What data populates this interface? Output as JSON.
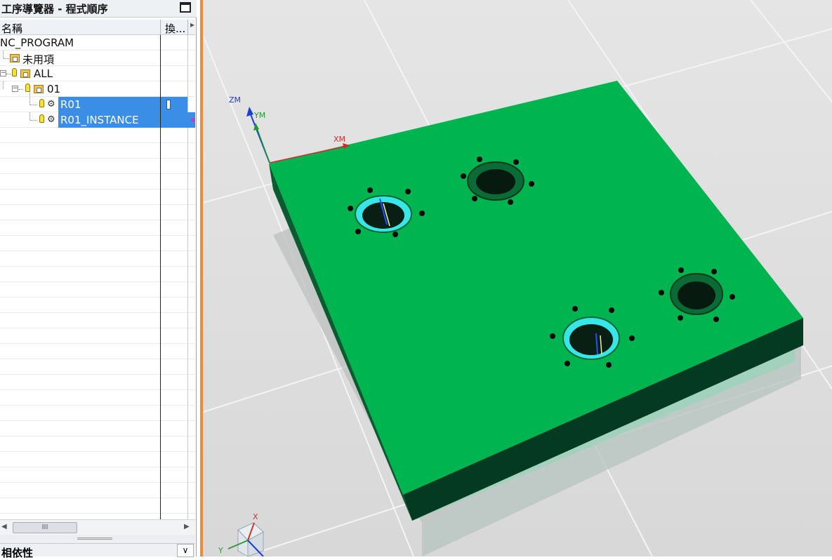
{
  "navigator": {
    "title": "工序導覽器 - 程式順序",
    "columns": {
      "name": "名稱",
      "change": "換..."
    },
    "tree": {
      "root": "NC_PROGRAM",
      "unused": "未用項",
      "all": "ALL",
      "group": "01",
      "ops": [
        "R01",
        "R01_INSTANCE"
      ]
    },
    "scrollbar": {
      "thumb": "III"
    },
    "dependencies_title": "相依性"
  },
  "viewport": {
    "wcs_axes": {
      "z": "ZM",
      "y": "YM",
      "x": "XM"
    },
    "triad": {
      "x": "X",
      "y": "Y"
    },
    "colors": {
      "part_top": "#00b54f",
      "part_side": "#053a22",
      "hole_highlight": "#37e6e6",
      "frame_accent": "#f08a3a",
      "selection": "#3a8ee6"
    }
  }
}
